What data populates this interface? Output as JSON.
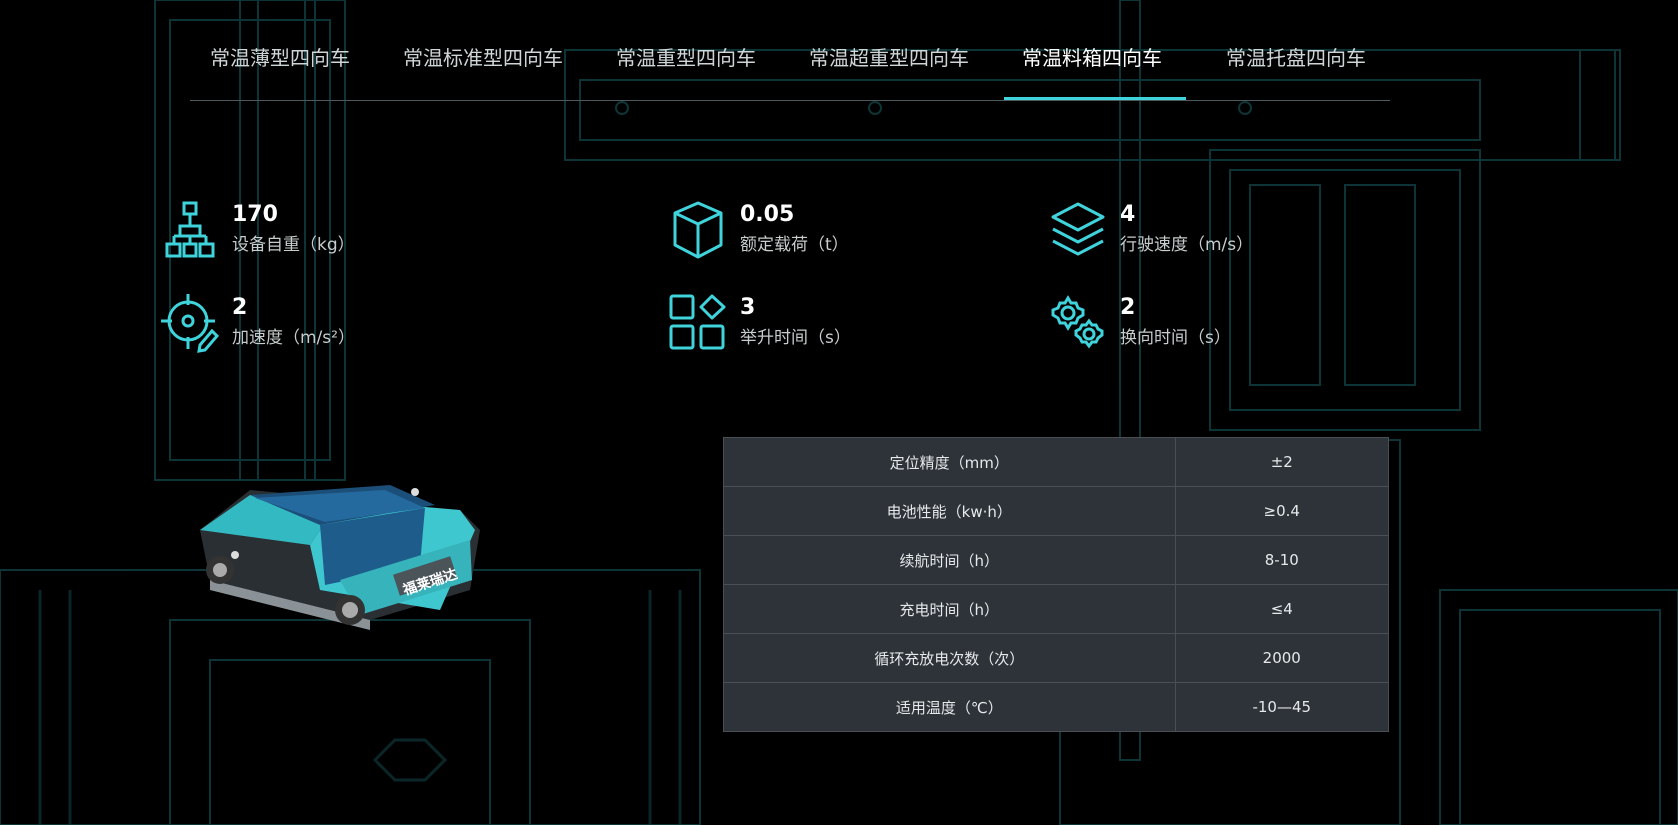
{
  "tabs": [
    {
      "label": "常温薄型四向车",
      "active": false
    },
    {
      "label": "常温标准型四向车",
      "active": false
    },
    {
      "label": "常温重型四向车",
      "active": false
    },
    {
      "label": "常温超重型四向车",
      "active": false
    },
    {
      "label": "常温料箱四向车",
      "active": true
    },
    {
      "label": "常温托盘四向车",
      "active": false
    }
  ],
  "specs": [
    {
      "value": "170",
      "label": "设备自重（kg）",
      "icon": "sitemap-icon"
    },
    {
      "value": "0.05",
      "label": "额定载荷（t）",
      "icon": "cube-icon"
    },
    {
      "value": "4",
      "label": "行驶速度（m/s）",
      "icon": "layers-icon"
    },
    {
      "value": "2",
      "label": "加速度（m/s²）",
      "icon": "crosshair-edit-icon"
    },
    {
      "value": "3",
      "label": "举升时间（s）",
      "icon": "apps-grid-icon"
    },
    {
      "value": "2",
      "label": "换向时间（s）",
      "icon": "gears-icon"
    }
  ],
  "table": {
    "rows": [
      {
        "key": "定位精度（mm）",
        "value": "±2"
      },
      {
        "key": "电池性能（kw·h）",
        "value": "≥0.4"
      },
      {
        "key": "续航时间（h）",
        "value": "8-10"
      },
      {
        "key": "充电时间（h）",
        "value": "≤4"
      },
      {
        "key": "循环充放电次数（次）",
        "value": "2000"
      },
      {
        "key": "适用温度（℃）",
        "value": "-10—45"
      }
    ]
  },
  "product": {
    "brand_text": "福莱瑞达"
  },
  "colors": {
    "accent": "#3fd3dc",
    "table_bg": "#2d3339",
    "background": "#000000"
  }
}
